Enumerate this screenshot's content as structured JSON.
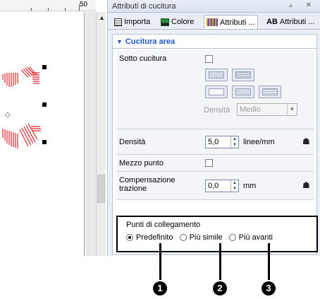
{
  "ruler": {
    "label": "50"
  },
  "panel": {
    "title": "Attributi di cucitura",
    "title_buttons": "⫨ ✕",
    "tabs": [
      {
        "label": "Importa"
      },
      {
        "label": "Colore"
      },
      {
        "label": "Attributi ..."
      },
      {
        "label": "Attributi ..."
      }
    ],
    "tab_ab_glyph": "AB",
    "section": {
      "arrow": "▼",
      "title": "Cucitura area"
    }
  },
  "rows": {
    "sotto_cucitura": {
      "label": "Sotto cucitura",
      "checked": false
    },
    "densita_small": {
      "label": "Densità",
      "value": "Medio"
    },
    "densita": {
      "label": "Densità",
      "value": "5,0",
      "unit": "linee/mm"
    },
    "mezzo_punto": {
      "label": "Mezzo punto",
      "checked": false
    },
    "compensazione": {
      "label": "Compensazione trazione",
      "value": "0,0",
      "unit": "mm"
    }
  },
  "punti": {
    "title": "Punti di collegamento",
    "options": [
      {
        "label": "Predefinito",
        "selected": true
      },
      {
        "label": "Più simile",
        "selected": false
      },
      {
        "label": "Più avanti",
        "selected": false
      }
    ]
  },
  "callouts": [
    "1",
    "2",
    "3"
  ],
  "colors": {
    "accent": "#1e58c8",
    "stitch_red": "#e0252b",
    "panel_bg": "#ecf0f6"
  }
}
